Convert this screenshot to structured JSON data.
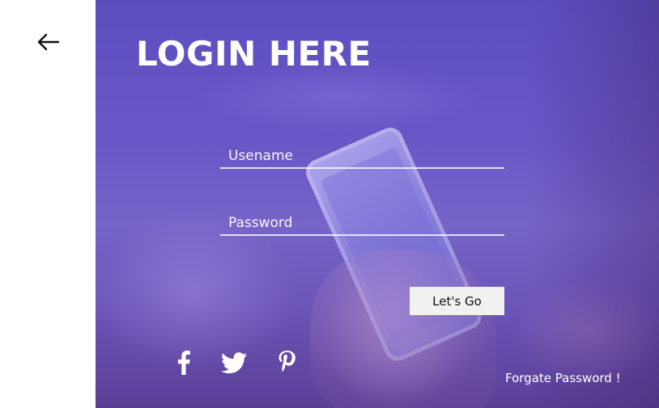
{
  "title": "LOGIN HERE",
  "form": {
    "username_placeholder": "Usename",
    "password_placeholder": "Password",
    "submit_label": "Let's Go"
  },
  "social": [
    "facebook-icon",
    "twitter-icon",
    "pinterest-icon"
  ],
  "forgot_password": "Forgate Password !",
  "colors": {
    "accent_overlay": "#6a57c6",
    "button_bg": "#f1f1f1",
    "text_light": "#ffffff"
  }
}
